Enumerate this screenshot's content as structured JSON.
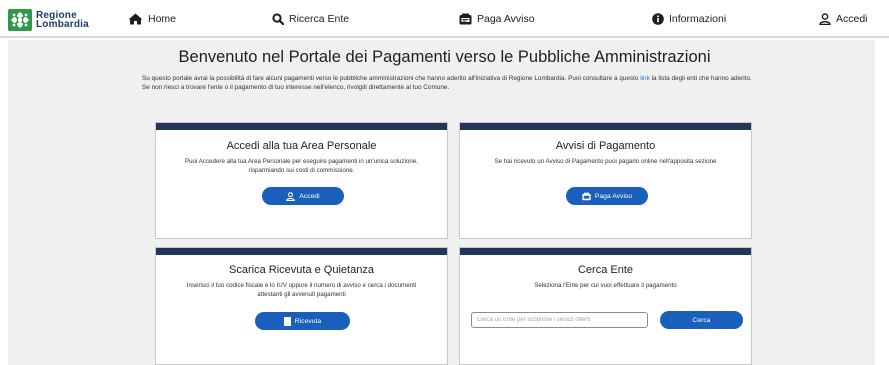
{
  "brand": {
    "line1": "Regione",
    "line2": "Lombardia"
  },
  "nav": {
    "home": "Home",
    "search_ente": "Ricerca Ente",
    "paga_avviso": "Paga Avviso",
    "informazioni": "Informazioni",
    "accedi": "Accedi"
  },
  "welcome": {
    "title": "Benvenuto nel Portale dei Pagamenti verso le Pubbliche Amministrazioni",
    "intro_part1": "Su questo portale avrai la possibilità di fare alcuni pagamenti verso le pubbliche amministrazioni che hanno aderito all'iniziativa di Regione Lombardia. Puoi consultare a questo ",
    "intro_link": "link",
    "intro_part2": " la lista degli enti che hanno aderito.",
    "intro_line2": "Se non riesci a trovare l'ente o il pagamento di tuo interesse nell'elenco, rivolgiti direttamente al tuo Comune."
  },
  "cards": {
    "area_personale": {
      "title": "Accedi alla tua Area Personale",
      "text": "Puoi Accedere alla tua Area Personale per eseguire pagamenti in un'unica soluzione, risparmiando sui costi di commissione.",
      "button": "Accedi"
    },
    "avvisi": {
      "title": "Avvisi di Pagamento",
      "text": "Se hai ricevuto un Avviso di Pagamento puoi pagarlo online nell'apposita sezione",
      "button": "Paga Avviso"
    },
    "ricevuta": {
      "title": "Scarica Ricevuta e Quietanza",
      "text": "Inserisci il tuo codice fiscale e lo IUV oppure il numero di avviso e cerca i documenti attestanti gli avvenuti pagamenti",
      "button": "Ricevuta"
    },
    "cerca_ente": {
      "title": "Cerca Ente",
      "text": "Seleziona l'Ente per cui vuoi effettuare il pagamento",
      "placeholder": "Cerca un Ente per scoprirne i servizi offerti",
      "button": "Cerca"
    }
  },
  "colors": {
    "card_band": "#233559",
    "button": "#1b5fbd",
    "logo_green": "#2e9a47",
    "link": "#2c6fc7"
  }
}
